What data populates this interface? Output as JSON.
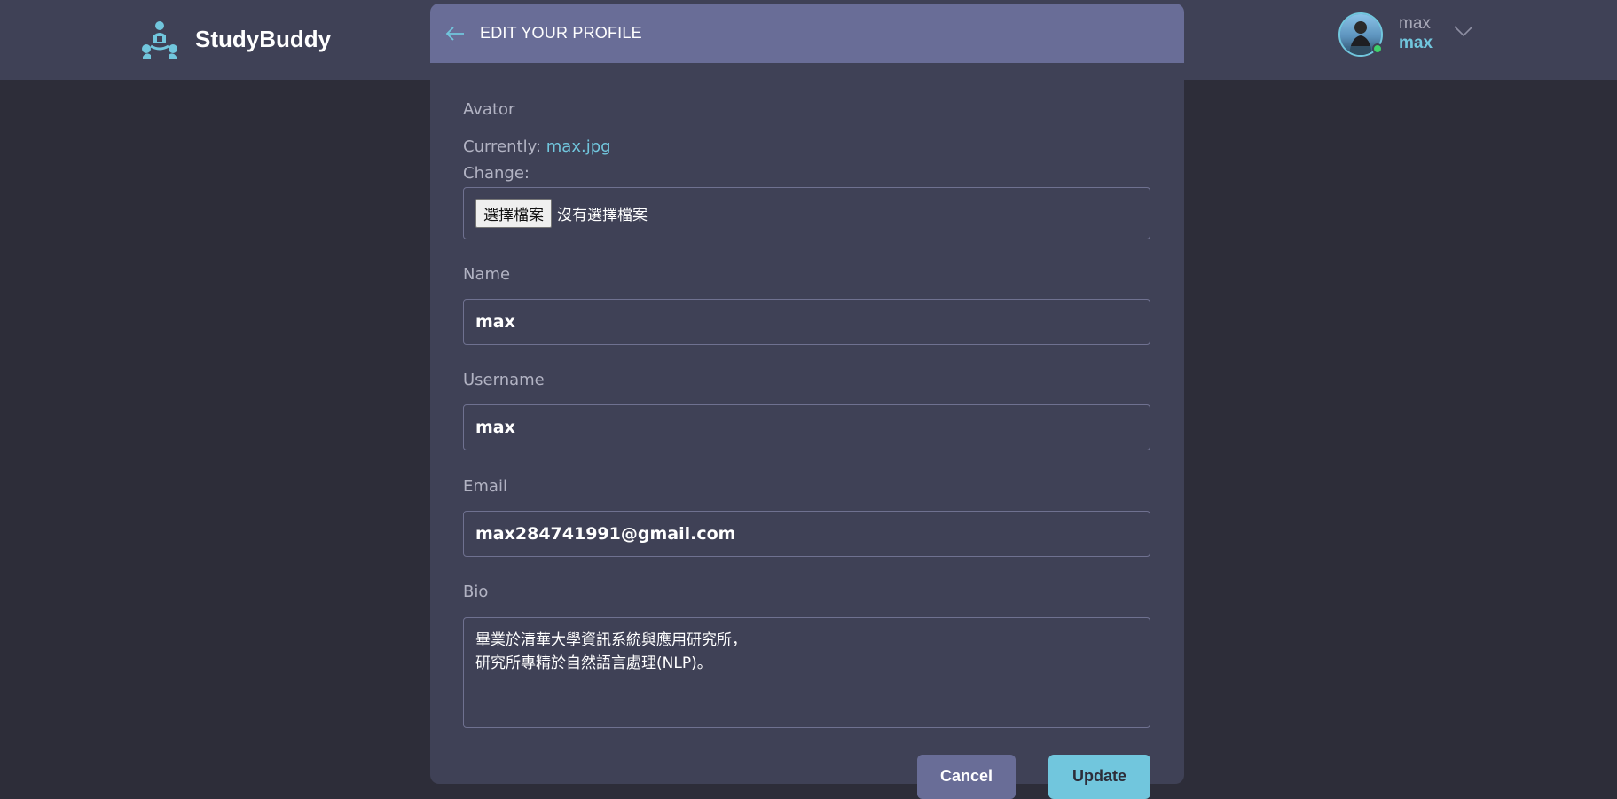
{
  "app": {
    "name": "StudyBuddy"
  },
  "user": {
    "name": "max",
    "username": "max"
  },
  "form": {
    "title": "EDIT YOUR PROFILE",
    "avatar": {
      "label": "Avator",
      "currently_label": "Currently:",
      "current_file": "max.jpg",
      "change_label": "Change:",
      "choose_button": "選擇檔案",
      "no_file": "沒有選擇檔案"
    },
    "name": {
      "label": "Name",
      "value": "max"
    },
    "username": {
      "label": "Username",
      "value": "max"
    },
    "email": {
      "label": "Email",
      "value": "max284741991@gmail.com"
    },
    "bio": {
      "label": "Bio",
      "value": "畢業於清華大學資訊系統與應用研究所，\n研究所專精於自然語言處理(NLP)。"
    },
    "cancel_label": "Cancel",
    "update_label": "Update"
  },
  "colors": {
    "accent": "#71c6dd",
    "header": "#3f4156",
    "background": "#2d2d39",
    "card_header": "#696d97"
  }
}
